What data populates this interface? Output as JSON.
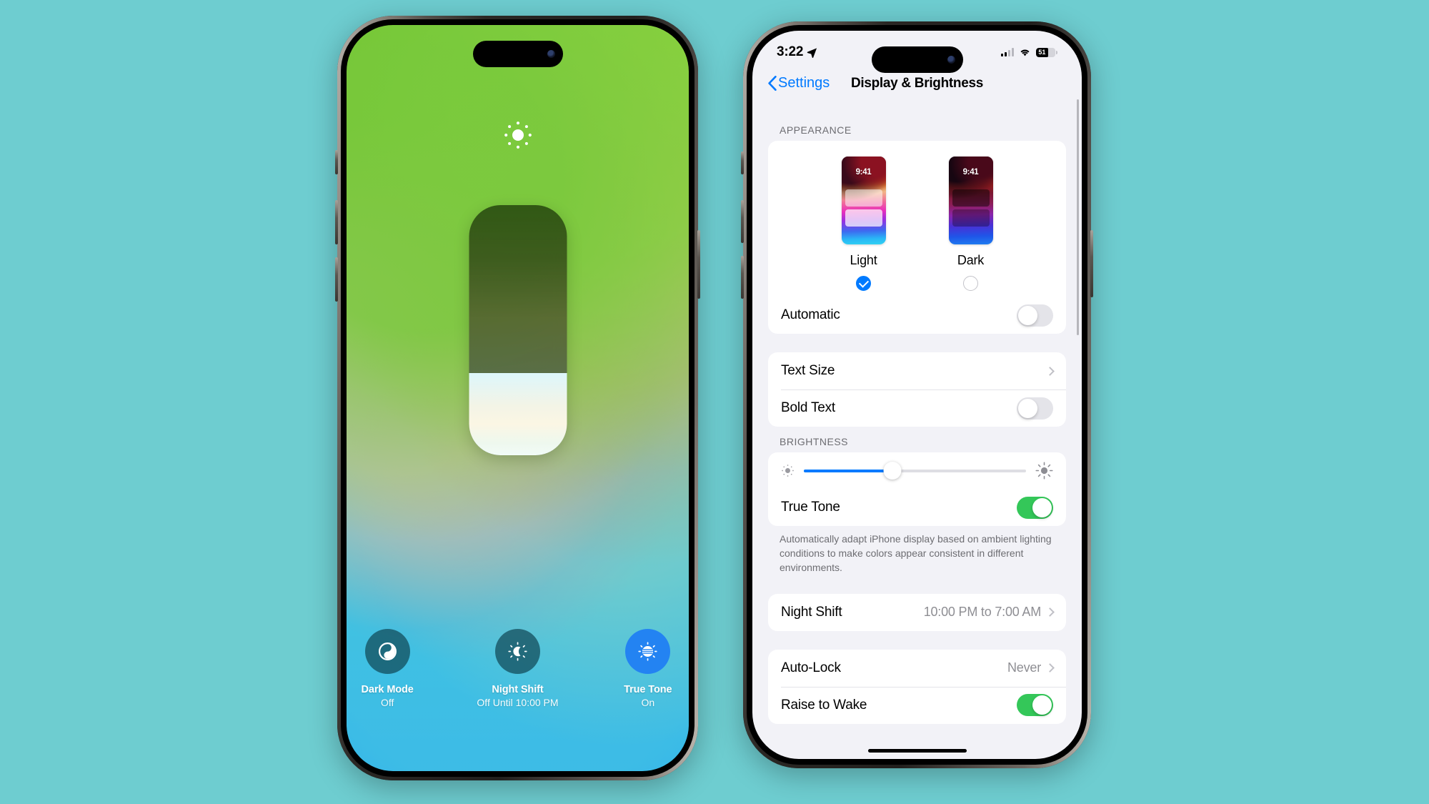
{
  "canvas": {
    "background": "#6ecdd0"
  },
  "left_phone": {
    "name": "Control Center brightness panel",
    "brightness_icon": "sun-icon",
    "slider": {
      "name": "brightness-slider",
      "fill_percent": 33
    },
    "controls": [
      {
        "id": "dark-mode",
        "icon": "dark-mode-icon",
        "title": "Dark Mode",
        "subtitle": "Off",
        "active": false,
        "color": "rgba(16,72,86,.72)"
      },
      {
        "id": "night-shift",
        "icon": "night-shift-icon",
        "title": "Night Shift",
        "subtitle": "Off Until 10:00 PM",
        "active": false,
        "color": "rgba(16,72,86,.72)"
      },
      {
        "id": "true-tone",
        "icon": "true-tone-icon",
        "title": "True Tone",
        "subtitle": "On",
        "active": true,
        "color": "#2383f2"
      }
    ]
  },
  "right_phone": {
    "status_bar": {
      "time": "3:22",
      "location_icon": "location-arrow-icon",
      "cellular_icon": "cellular-bars-icon",
      "wifi_icon": "wifi-icon",
      "battery_percent": "51"
    },
    "nav": {
      "back_label": "Settings",
      "title": "Display & Brightness"
    },
    "appearance": {
      "header": "APPEARANCE",
      "options": [
        {
          "label": "Light",
          "wallpaper_time": "9:41",
          "selected": true
        },
        {
          "label": "Dark",
          "wallpaper_time": "9:41",
          "selected": false
        }
      ],
      "automatic": {
        "label": "Automatic",
        "on": false
      }
    },
    "text_group": [
      {
        "label": "Text Size",
        "type": "disclosure",
        "value": ""
      },
      {
        "label": "Bold Text",
        "type": "toggle",
        "on": false
      }
    ],
    "brightness": {
      "header": "BRIGHTNESS",
      "slider": {
        "name": "brightness-slider",
        "value_percent": 40,
        "low_icon": "brightness-low-icon",
        "high_icon": "brightness-high-icon"
      },
      "true_tone": {
        "label": "True Tone",
        "on": true
      },
      "footnote": "Automatically adapt iPhone display based on ambient lighting conditions to make colors appear consistent in different environments."
    },
    "night_shift": {
      "label": "Night Shift",
      "value": "10:00 PM to 7:00 AM"
    },
    "lock_group": [
      {
        "label": "Auto-Lock",
        "type": "disclosure",
        "value": "Never"
      },
      {
        "label": "Raise to Wake",
        "type": "toggle",
        "on": true
      }
    ]
  },
  "colors": {
    "accent_blue": "#007aff",
    "toggle_green": "#34c759",
    "group_bg": "#ffffff",
    "page_bg": "#f2f2f7",
    "secondary_text": "#8e8e93"
  }
}
